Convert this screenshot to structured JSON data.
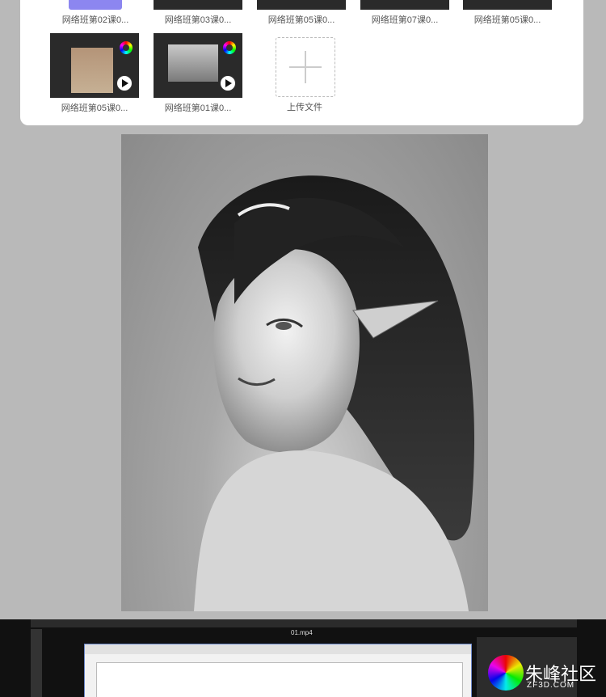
{
  "gallery": {
    "top_row": [
      {
        "caption": "网络班第02课0..."
      },
      {
        "caption": "网络班第03课0..."
      },
      {
        "caption": "网络班第05课0..."
      },
      {
        "caption": "网络班第07课0..."
      },
      {
        "caption": "网络班第05课0..."
      }
    ],
    "second_row": [
      {
        "caption": "网络班第05课0..."
      },
      {
        "caption": "网络班第01课0..."
      }
    ],
    "upload_label": "上传文件"
  },
  "screenshot_strip": {
    "tab_title": "01.mp4"
  },
  "watermark": {
    "name": "朱峰社区",
    "site": "ZF3D.COM"
  }
}
